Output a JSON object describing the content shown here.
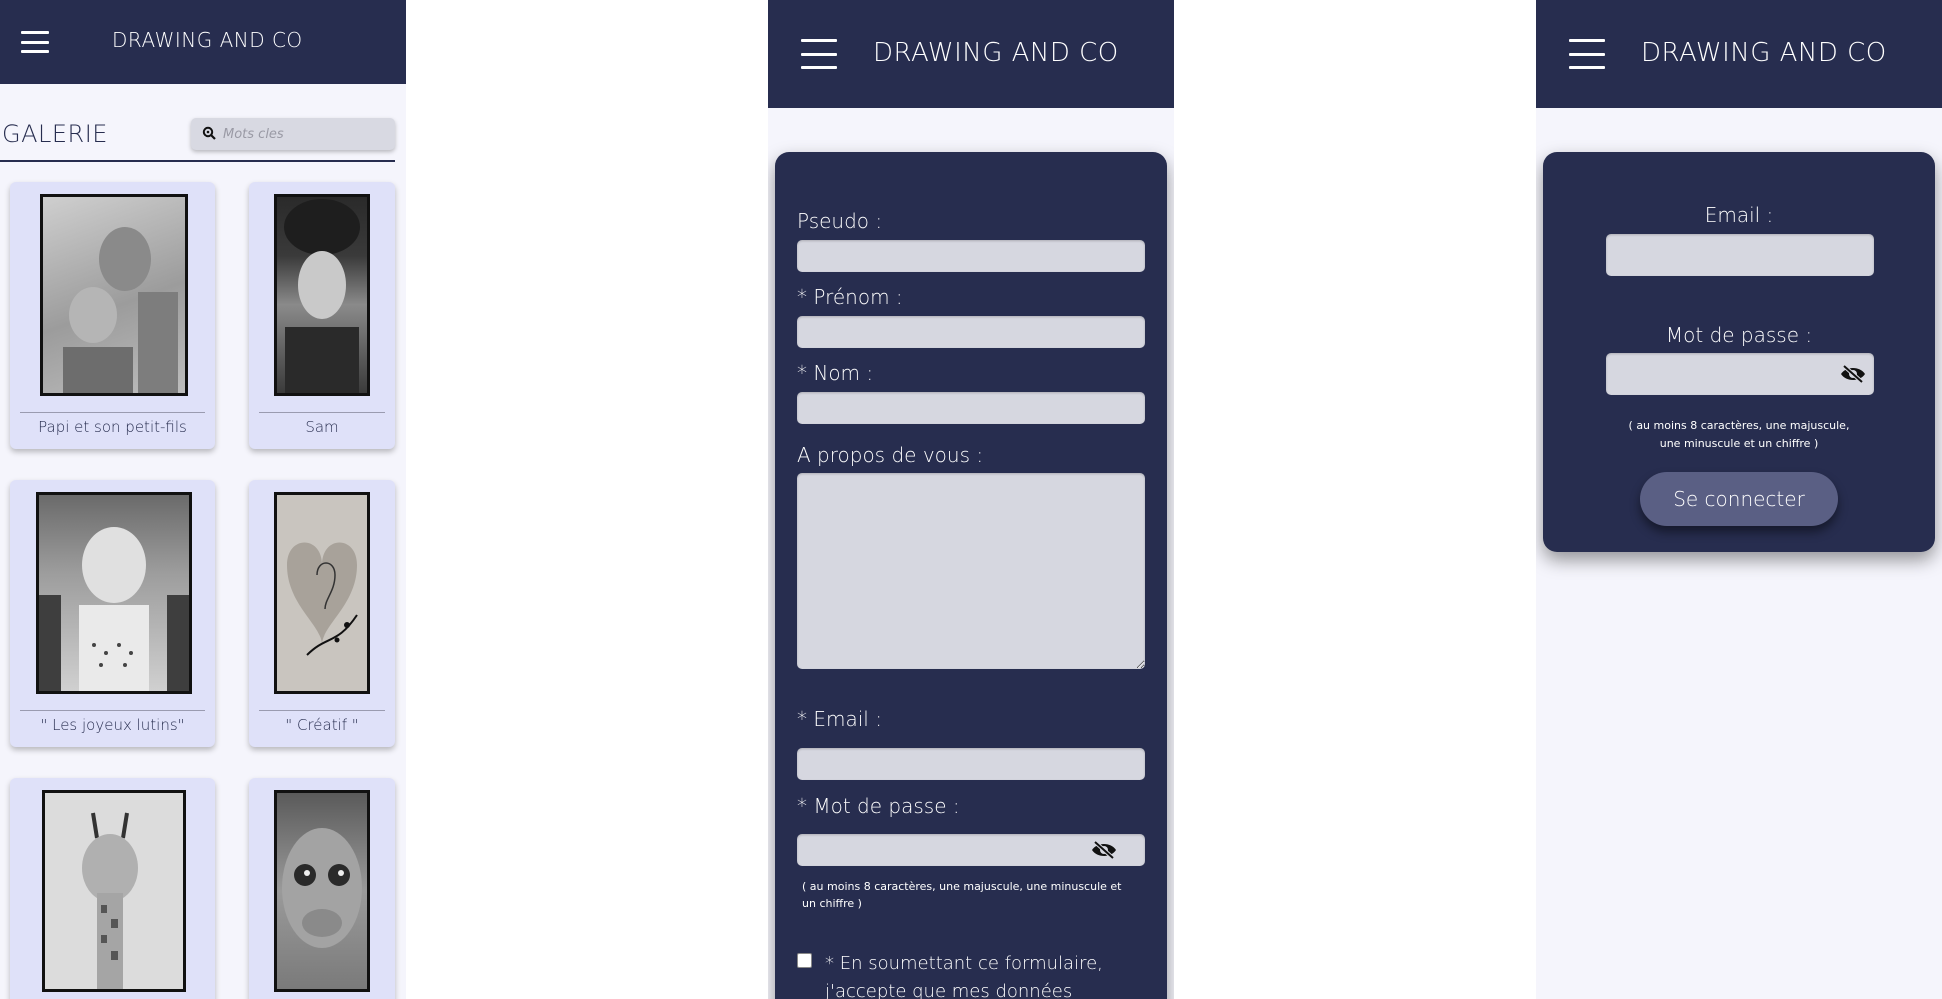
{
  "brand": "DRAWING AND CO",
  "gallery": {
    "title": "GALERIE",
    "search_placeholder": "Mots cles",
    "cards": [
      {
        "caption": "Papi et son petit-fils"
      },
      {
        "caption": "Sam"
      },
      {
        "caption": "\" Les joyeux lutins\""
      },
      {
        "caption": "\" Créatif \""
      },
      {
        "caption": ""
      },
      {
        "caption": ""
      }
    ]
  },
  "signup": {
    "pseudo_label": "Pseudo :",
    "prenom_label": "* Prénom :",
    "nom_label": "* Nom :",
    "about_label": "A propos de vous :",
    "email_label": "* Email :",
    "password_label": "* Mot de passe :",
    "password_hint": "( au moins 8 caractères, une majuscule, une minuscule et un chiffre )",
    "consent_line1": "* En soumettant ce formulaire,",
    "consent_line2": "j'accepte que mes données"
  },
  "login": {
    "email_label": "Email :",
    "password_label": "Mot de passe :",
    "password_hint_line1": "( au moins 8 caractères, une majuscule,",
    "password_hint_line2": "une minuscule et un chiffre )",
    "submit_label": "Se connecter"
  },
  "icons": {
    "menu": "hamburger-menu-icon",
    "search": "search-icon",
    "hide_password": "eye-slash-icon"
  },
  "colors": {
    "header_bg": "#272d4f",
    "page_bg": "#f5f5fc",
    "card_bg": "#dfe1f9",
    "field_bg": "#d6d7e0",
    "button_bg": "#5a5f84"
  }
}
